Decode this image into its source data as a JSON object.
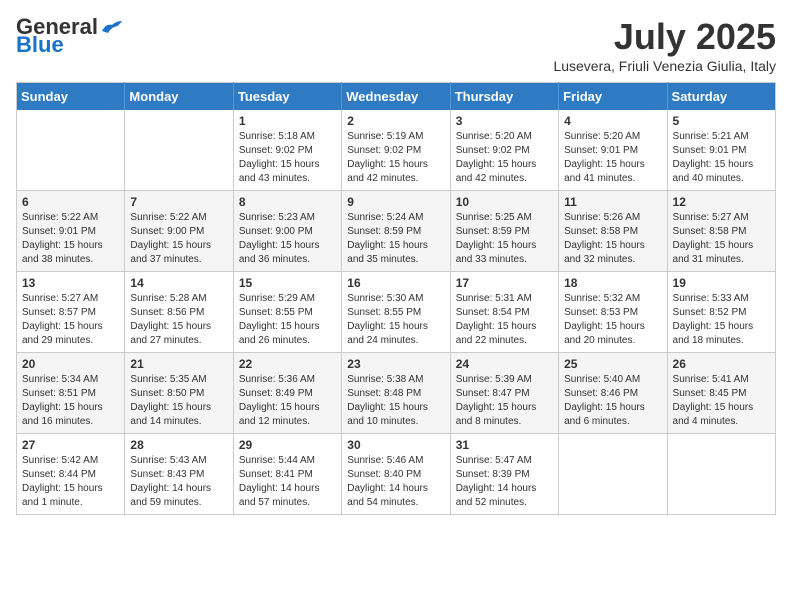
{
  "header": {
    "logo_general": "General",
    "logo_blue": "Blue",
    "month": "July 2025",
    "location": "Lusevera, Friuli Venezia Giulia, Italy"
  },
  "days_of_week": [
    "Sunday",
    "Monday",
    "Tuesday",
    "Wednesday",
    "Thursday",
    "Friday",
    "Saturday"
  ],
  "weeks": [
    [
      {
        "day": "",
        "content": ""
      },
      {
        "day": "",
        "content": ""
      },
      {
        "day": "1",
        "content": "Sunrise: 5:18 AM\nSunset: 9:02 PM\nDaylight: 15 hours and 43 minutes."
      },
      {
        "day": "2",
        "content": "Sunrise: 5:19 AM\nSunset: 9:02 PM\nDaylight: 15 hours and 42 minutes."
      },
      {
        "day": "3",
        "content": "Sunrise: 5:20 AM\nSunset: 9:02 PM\nDaylight: 15 hours and 42 minutes."
      },
      {
        "day": "4",
        "content": "Sunrise: 5:20 AM\nSunset: 9:01 PM\nDaylight: 15 hours and 41 minutes."
      },
      {
        "day": "5",
        "content": "Sunrise: 5:21 AM\nSunset: 9:01 PM\nDaylight: 15 hours and 40 minutes."
      }
    ],
    [
      {
        "day": "6",
        "content": "Sunrise: 5:22 AM\nSunset: 9:01 PM\nDaylight: 15 hours and 38 minutes."
      },
      {
        "day": "7",
        "content": "Sunrise: 5:22 AM\nSunset: 9:00 PM\nDaylight: 15 hours and 37 minutes."
      },
      {
        "day": "8",
        "content": "Sunrise: 5:23 AM\nSunset: 9:00 PM\nDaylight: 15 hours and 36 minutes."
      },
      {
        "day": "9",
        "content": "Sunrise: 5:24 AM\nSunset: 8:59 PM\nDaylight: 15 hours and 35 minutes."
      },
      {
        "day": "10",
        "content": "Sunrise: 5:25 AM\nSunset: 8:59 PM\nDaylight: 15 hours and 33 minutes."
      },
      {
        "day": "11",
        "content": "Sunrise: 5:26 AM\nSunset: 8:58 PM\nDaylight: 15 hours and 32 minutes."
      },
      {
        "day": "12",
        "content": "Sunrise: 5:27 AM\nSunset: 8:58 PM\nDaylight: 15 hours and 31 minutes."
      }
    ],
    [
      {
        "day": "13",
        "content": "Sunrise: 5:27 AM\nSunset: 8:57 PM\nDaylight: 15 hours and 29 minutes."
      },
      {
        "day": "14",
        "content": "Sunrise: 5:28 AM\nSunset: 8:56 PM\nDaylight: 15 hours and 27 minutes."
      },
      {
        "day": "15",
        "content": "Sunrise: 5:29 AM\nSunset: 8:55 PM\nDaylight: 15 hours and 26 minutes."
      },
      {
        "day": "16",
        "content": "Sunrise: 5:30 AM\nSunset: 8:55 PM\nDaylight: 15 hours and 24 minutes."
      },
      {
        "day": "17",
        "content": "Sunrise: 5:31 AM\nSunset: 8:54 PM\nDaylight: 15 hours and 22 minutes."
      },
      {
        "day": "18",
        "content": "Sunrise: 5:32 AM\nSunset: 8:53 PM\nDaylight: 15 hours and 20 minutes."
      },
      {
        "day": "19",
        "content": "Sunrise: 5:33 AM\nSunset: 8:52 PM\nDaylight: 15 hours and 18 minutes."
      }
    ],
    [
      {
        "day": "20",
        "content": "Sunrise: 5:34 AM\nSunset: 8:51 PM\nDaylight: 15 hours and 16 minutes."
      },
      {
        "day": "21",
        "content": "Sunrise: 5:35 AM\nSunset: 8:50 PM\nDaylight: 15 hours and 14 minutes."
      },
      {
        "day": "22",
        "content": "Sunrise: 5:36 AM\nSunset: 8:49 PM\nDaylight: 15 hours and 12 minutes."
      },
      {
        "day": "23",
        "content": "Sunrise: 5:38 AM\nSunset: 8:48 PM\nDaylight: 15 hours and 10 minutes."
      },
      {
        "day": "24",
        "content": "Sunrise: 5:39 AM\nSunset: 8:47 PM\nDaylight: 15 hours and 8 minutes."
      },
      {
        "day": "25",
        "content": "Sunrise: 5:40 AM\nSunset: 8:46 PM\nDaylight: 15 hours and 6 minutes."
      },
      {
        "day": "26",
        "content": "Sunrise: 5:41 AM\nSunset: 8:45 PM\nDaylight: 15 hours and 4 minutes."
      }
    ],
    [
      {
        "day": "27",
        "content": "Sunrise: 5:42 AM\nSunset: 8:44 PM\nDaylight: 15 hours and 1 minute."
      },
      {
        "day": "28",
        "content": "Sunrise: 5:43 AM\nSunset: 8:43 PM\nDaylight: 14 hours and 59 minutes."
      },
      {
        "day": "29",
        "content": "Sunrise: 5:44 AM\nSunset: 8:41 PM\nDaylight: 14 hours and 57 minutes."
      },
      {
        "day": "30",
        "content": "Sunrise: 5:46 AM\nSunset: 8:40 PM\nDaylight: 14 hours and 54 minutes."
      },
      {
        "day": "31",
        "content": "Sunrise: 5:47 AM\nSunset: 8:39 PM\nDaylight: 14 hours and 52 minutes."
      },
      {
        "day": "",
        "content": ""
      },
      {
        "day": "",
        "content": ""
      }
    ]
  ]
}
